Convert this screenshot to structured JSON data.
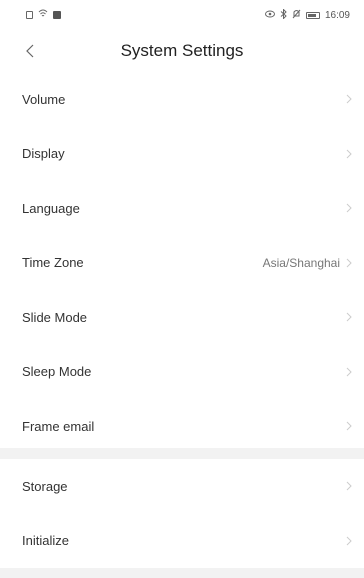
{
  "status_bar": {
    "time": "16:09",
    "left_icons": [
      "notification-icon",
      "wifi-icon",
      "image-icon"
    ],
    "right_icons": [
      "eye-icon",
      "bluetooth-icon",
      "mute-icon",
      "battery-icon"
    ]
  },
  "header": {
    "title": "System Settings",
    "back_icon": "chevron-left-icon"
  },
  "settings": [
    {
      "label": "Volume",
      "value": ""
    },
    {
      "label": "Display",
      "value": ""
    },
    {
      "label": "Language",
      "value": ""
    },
    {
      "label": "Time Zone",
      "value": "Asia/Shanghai"
    },
    {
      "label": "Slide Mode",
      "value": ""
    },
    {
      "label": "Sleep Mode",
      "value": ""
    },
    {
      "label": "Frame email",
      "value": ""
    }
  ],
  "settings_2": [
    {
      "label": "Storage"
    },
    {
      "label": "Initialize"
    }
  ],
  "colors": {
    "background": "#ffffff",
    "section_gap": "#f2f2f2",
    "text": "#333333",
    "value_text": "#777777",
    "chevron": "#cccccc"
  }
}
